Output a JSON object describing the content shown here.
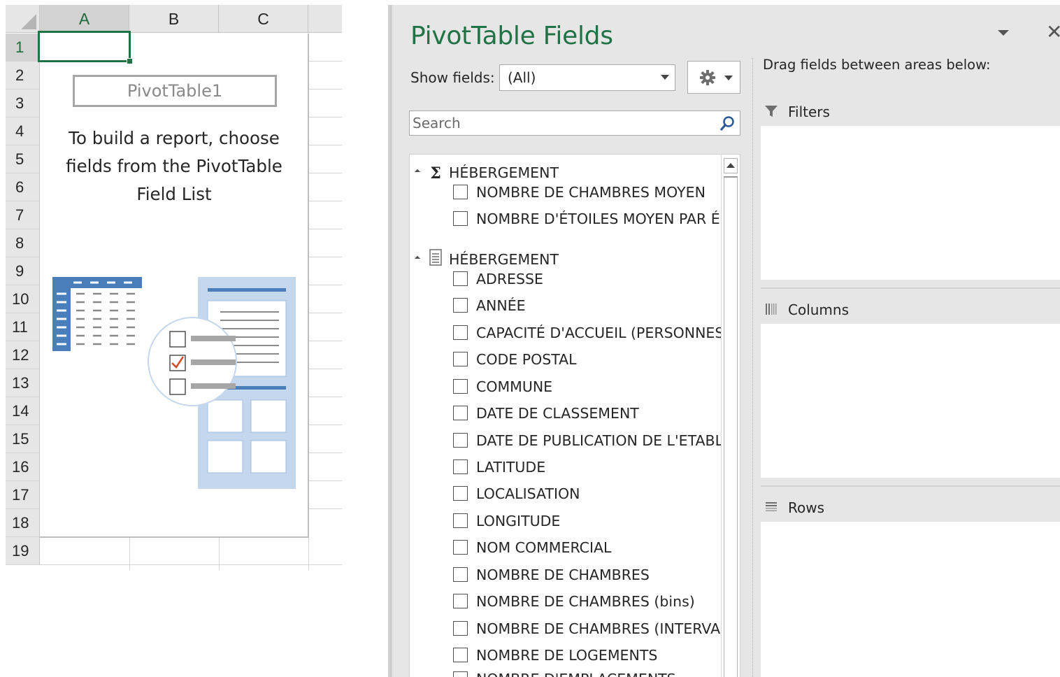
{
  "sheet": {
    "columns": [
      "A",
      "B",
      "C"
    ],
    "rows": [
      "1",
      "2",
      "3",
      "4",
      "5",
      "6",
      "7",
      "8",
      "9",
      "10",
      "11",
      "12",
      "13",
      "14",
      "15",
      "16",
      "17",
      "18",
      "19"
    ],
    "selected_column": "A",
    "selected_row": "1",
    "pivot": {
      "name": "PivotTable1",
      "instruction": "To build a report, choose fields from the PivotTable Field List"
    }
  },
  "pane": {
    "title": "PivotTable Fields",
    "show_fields_label": "Show fields:",
    "show_fields_value": "(All)",
    "search_placeholder": "Search",
    "drag_hint": "Drag fields between areas below:",
    "groups": [
      {
        "name": "HÉBERGEMENT",
        "icon": "sigma-icon",
        "fields": [
          "NOMBRE DE CHAMBRES MOYEN",
          "NOMBRE D'ÉTOILES MOYEN PAR É..."
        ]
      },
      {
        "name": "HÉBERGEMENT",
        "icon": "table-icon",
        "fields": [
          "ADRESSE",
          "ANNÉE",
          "CAPACITÉ D'ACCUEIL (PERSONNES)",
          "CODE POSTAL",
          "COMMUNE",
          "DATE DE CLASSEMENT",
          "DATE DE PUBLICATION DE L'ETABL...",
          "LATITUDE",
          "LOCALISATION",
          "LONGITUDE",
          "NOM COMMERCIAL",
          "NOMBRE DE CHAMBRES",
          "NOMBRE DE CHAMBRES (bins)",
          "NOMBRE DE CHAMBRES (INTERVA...",
          "NOMBRE DE LOGEMENTS",
          "NOMBRE D'EMPLACEMENTS"
        ]
      }
    ],
    "areas": {
      "filters": "Filters",
      "columns": "Columns",
      "rows": "Rows"
    }
  },
  "colors": {
    "excel_green": "#217346",
    "illustration_blue": "#4a7ebb",
    "illustration_light": "#c5d7ec"
  }
}
